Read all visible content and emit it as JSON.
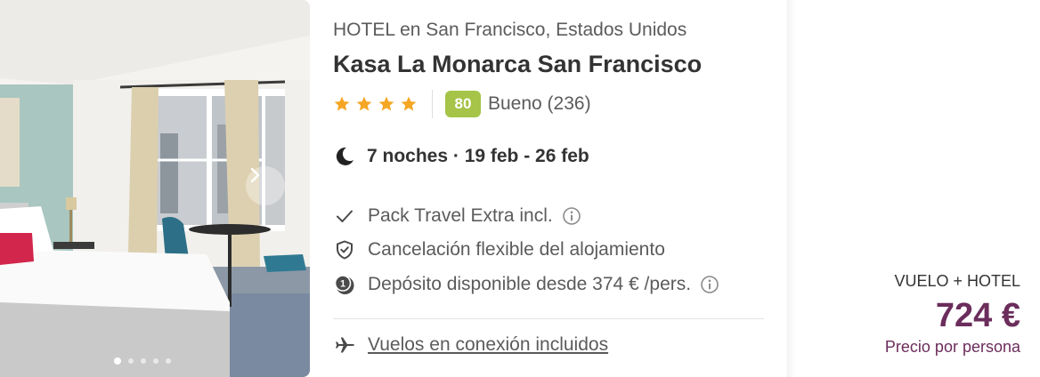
{
  "hotel": {
    "location": "HOTEL en San Francisco, Estados Unidos",
    "name": "Kasa La Monarca San Francisco",
    "stars": 4,
    "score": "80",
    "rating_text": "Bueno (236)"
  },
  "stay": {
    "dates_text": "7 noches · 19 feb - 26 feb"
  },
  "features": [
    {
      "icon": "check-icon",
      "text": "Pack Travel Extra incl."
    },
    {
      "icon": "shield-check-icon",
      "text": "Cancelación flexible del alojamiento"
    },
    {
      "icon": "deposit-icon",
      "text": "Depósito disponible desde 374 € /pers."
    }
  ],
  "flights": {
    "icon": "airplane-icon",
    "text": "Vuelos en conexión incluidos"
  },
  "price": {
    "package_label": "VUELO + HOTEL",
    "amount": "724 €",
    "note": "Precio por persona"
  },
  "carousel": {
    "total_images": 5,
    "active_index": 0
  },
  "colors": {
    "score_badge": "#a6c448",
    "star": "#f5a623",
    "price": "#6b2d5b"
  }
}
